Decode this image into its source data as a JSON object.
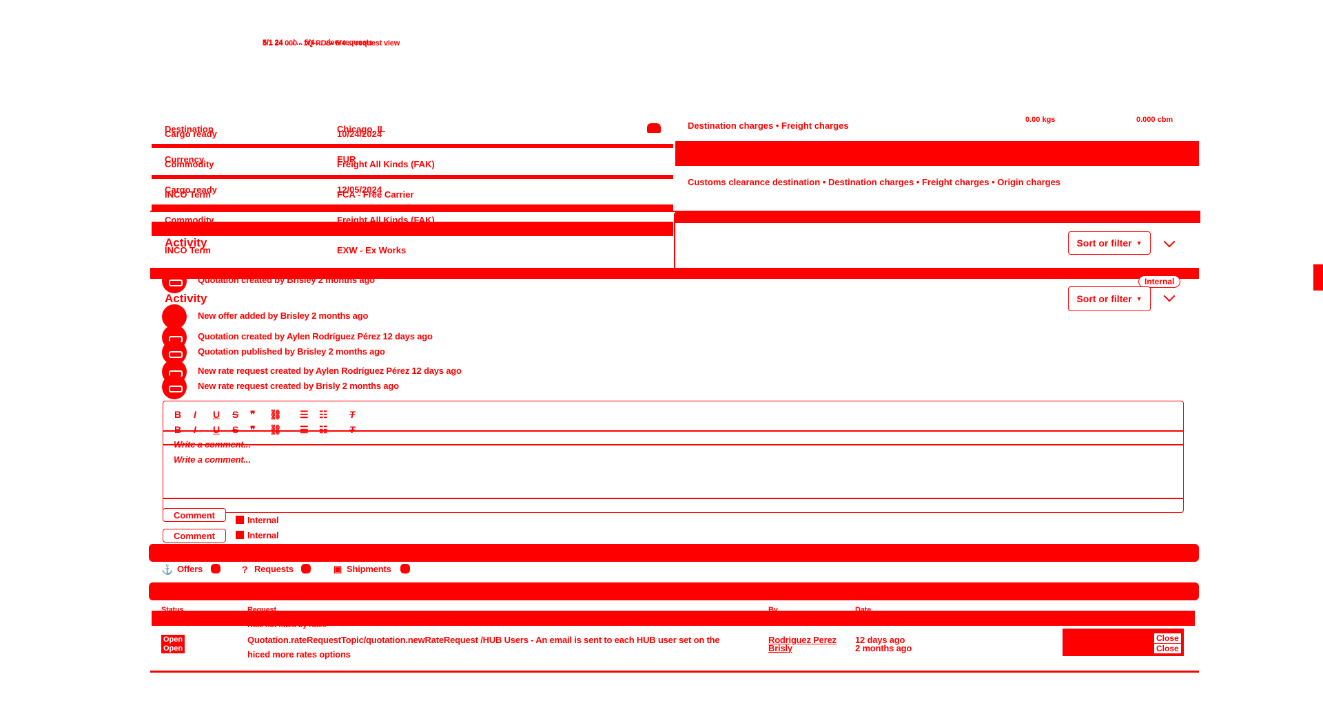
{
  "header": {
    "breadcrumb_a": "5/1 24 ... / ... 5/4 ... view requests",
    "breadcrumb_b": "5/1 24 000 - 1Q-RDS- 5/4 ... request view"
  },
  "details_left": {
    "rows_a": [
      {
        "label": "Destination",
        "value": "Chicago, IL"
      },
      {
        "label": "Currency",
        "value": "EUR"
      },
      {
        "label": "Cargo ready",
        "value": "12/05/2024"
      },
      {
        "label": "Commodity",
        "value": "Freight All Kinds (FAK)"
      },
      {
        "label": "INCO Term",
        "value": "EXW - Ex Works"
      }
    ],
    "rows_b": [
      {
        "label": "Cargo ready",
        "value": "10/24/2024"
      },
      {
        "label": "Commodity",
        "value": "Freight All Kinds (FAK)"
      },
      {
        "label": "INCO Term",
        "value": "FCA - Free Carrier"
      }
    ]
  },
  "details_right": {
    "charges_a": "Destination charges • Freight charges",
    "charges_b": "Customs clearance destination • Destination charges • Freight charges • Origin charges",
    "weight": "0.00 kgs",
    "volume": "0.000 cbm"
  },
  "activity": {
    "title": "Activity",
    "sort_label": "Sort or filter",
    "internal_label": "Internal",
    "items": [
      "Quotation created by Brisley 2 months ago",
      "New offer added by Brisley 2 months ago",
      "Quotation created by Aylen Rodríguez Pérez 12 days ago",
      "Quotation published by Brisley 2 months ago",
      "New rate request created by Aylen Rodríguez Pérez 12 days ago",
      "New rate request created by Brisly 2 months ago"
    ]
  },
  "editor": {
    "placeholder": "Write a comment...",
    "comment_button": "Comment",
    "internal_label": "Internal"
  },
  "tabs": [
    {
      "label": "Offers"
    },
    {
      "label": "Requests"
    },
    {
      "label": "Shipments"
    }
  ],
  "table": {
    "headers": [
      "Status",
      "Request",
      "By",
      "Date"
    ],
    "sub_header": "Rate not fitted by rules",
    "rows": [
      {
        "status": "Open",
        "request": "Quotation.rateRequestTopic/quotation.newRateRequest /HUB Users - An email is sent to each HUB user set on the",
        "request_line2": "hiced more rates options",
        "by": "Rodriguez Perez",
        "date": "12 days ago",
        "actions": [
          "Close",
          "Close"
        ]
      },
      {
        "status": "Open",
        "request": "Quotation.rateRequestTopic",
        "request_line2": "",
        "by": "Brisly",
        "date": "2 months ago",
        "actions": [
          "Close",
          "Close"
        ]
      }
    ]
  }
}
